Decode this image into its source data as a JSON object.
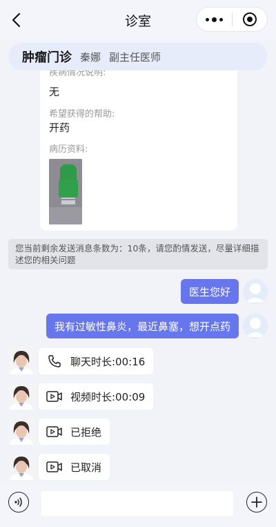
{
  "header": {
    "title": "诊室",
    "back_icon": "chevron-left-icon",
    "more_icon": "more-dots-icon",
    "close_icon": "target-circle-icon"
  },
  "doctor_bar": {
    "department": "肿瘤门诊",
    "doctor_name": "秦娜",
    "title": "副主任医师",
    "background": "#e6ecf9"
  },
  "consult_card": {
    "clipped_label": "疾病情况说明:",
    "condition_value": "无",
    "help_label": "希望获得的帮助:",
    "help_value": "开药",
    "records_label": "病历资料:",
    "record_thumbnail": "green-bottle-photo"
  },
  "notice": {
    "text": "您当前剩余发送消息条数为：10条，请您酌情发送，尽量详细描述您的相关问题"
  },
  "messages": {
    "user_1": "医生您好",
    "user_2": "我有过敏性鼻炎，最近鼻塞，想开点药",
    "call_1": "聊天时长:00:16",
    "call_2": "视频时长:00:09",
    "call_3": "已拒绝",
    "call_4": "已取消",
    "user_bubble_color": "#6776ec",
    "icons": [
      "phone-icon",
      "video-icon",
      "video-icon",
      "video-icon"
    ]
  },
  "input_bar": {
    "placeholder": "",
    "voice_icon": "voice-icon",
    "plus_icon": "plus-icon"
  }
}
